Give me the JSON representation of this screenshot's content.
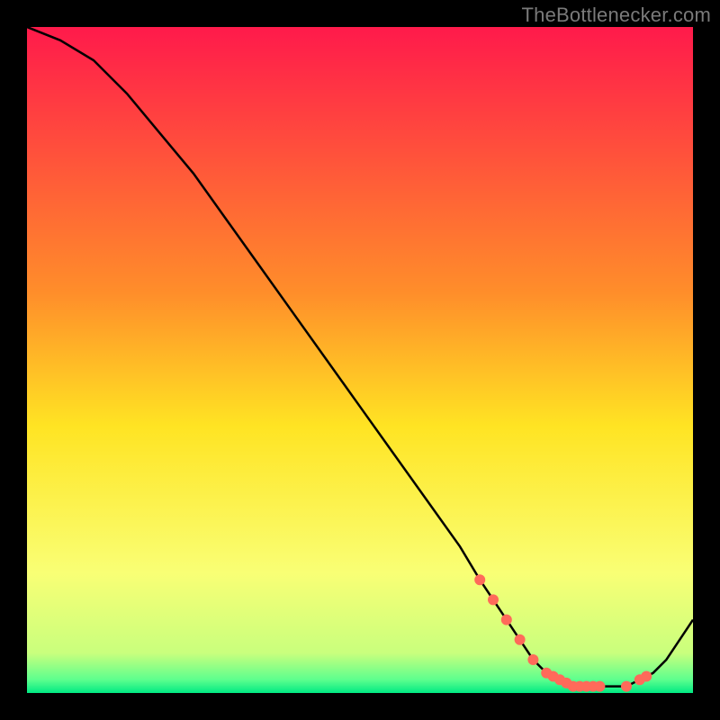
{
  "attribution": "TheBottlenecker.com",
  "chart_data": {
    "type": "line",
    "title": "",
    "xlabel": "",
    "ylabel": "",
    "xlim": [
      0,
      100
    ],
    "ylim": [
      0,
      100
    ],
    "gradient_stops": [
      {
        "offset": 0,
        "color": "#ff1a4b"
      },
      {
        "offset": 40,
        "color": "#ff8e2a"
      },
      {
        "offset": 60,
        "color": "#ffe423"
      },
      {
        "offset": 82,
        "color": "#f9ff75"
      },
      {
        "offset": 94,
        "color": "#c9ff7d"
      },
      {
        "offset": 98,
        "color": "#5dff8e"
      },
      {
        "offset": 100,
        "color": "#00e983"
      }
    ],
    "series": [
      {
        "name": "bottleneck-curve",
        "color": "#000000",
        "x": [
          0,
          5,
          10,
          15,
          20,
          25,
          30,
          35,
          40,
          45,
          50,
          55,
          60,
          65,
          68,
          72,
          74,
          76,
          78,
          80,
          82,
          84,
          86,
          88,
          90,
          92,
          94,
          96,
          98,
          100
        ],
        "y": [
          100,
          98,
          95,
          90,
          84,
          78,
          71,
          64,
          57,
          50,
          43,
          36,
          29,
          22,
          17,
          11,
          8,
          5,
          3,
          2,
          1,
          1,
          1,
          1,
          1,
          2,
          3,
          5,
          8,
          11
        ]
      }
    ],
    "markers": {
      "name": "highlight-points",
      "color": "#ff6a5a",
      "radius": 6,
      "x": [
        68,
        70,
        72,
        74,
        76,
        78,
        79,
        80,
        81,
        82,
        83,
        84,
        85,
        86,
        90,
        92,
        93
      ],
      "y": [
        17,
        14,
        11,
        8,
        5,
        3,
        2.5,
        2,
        1.5,
        1,
        1,
        1,
        1,
        1,
        1,
        2,
        2.5
      ]
    }
  }
}
